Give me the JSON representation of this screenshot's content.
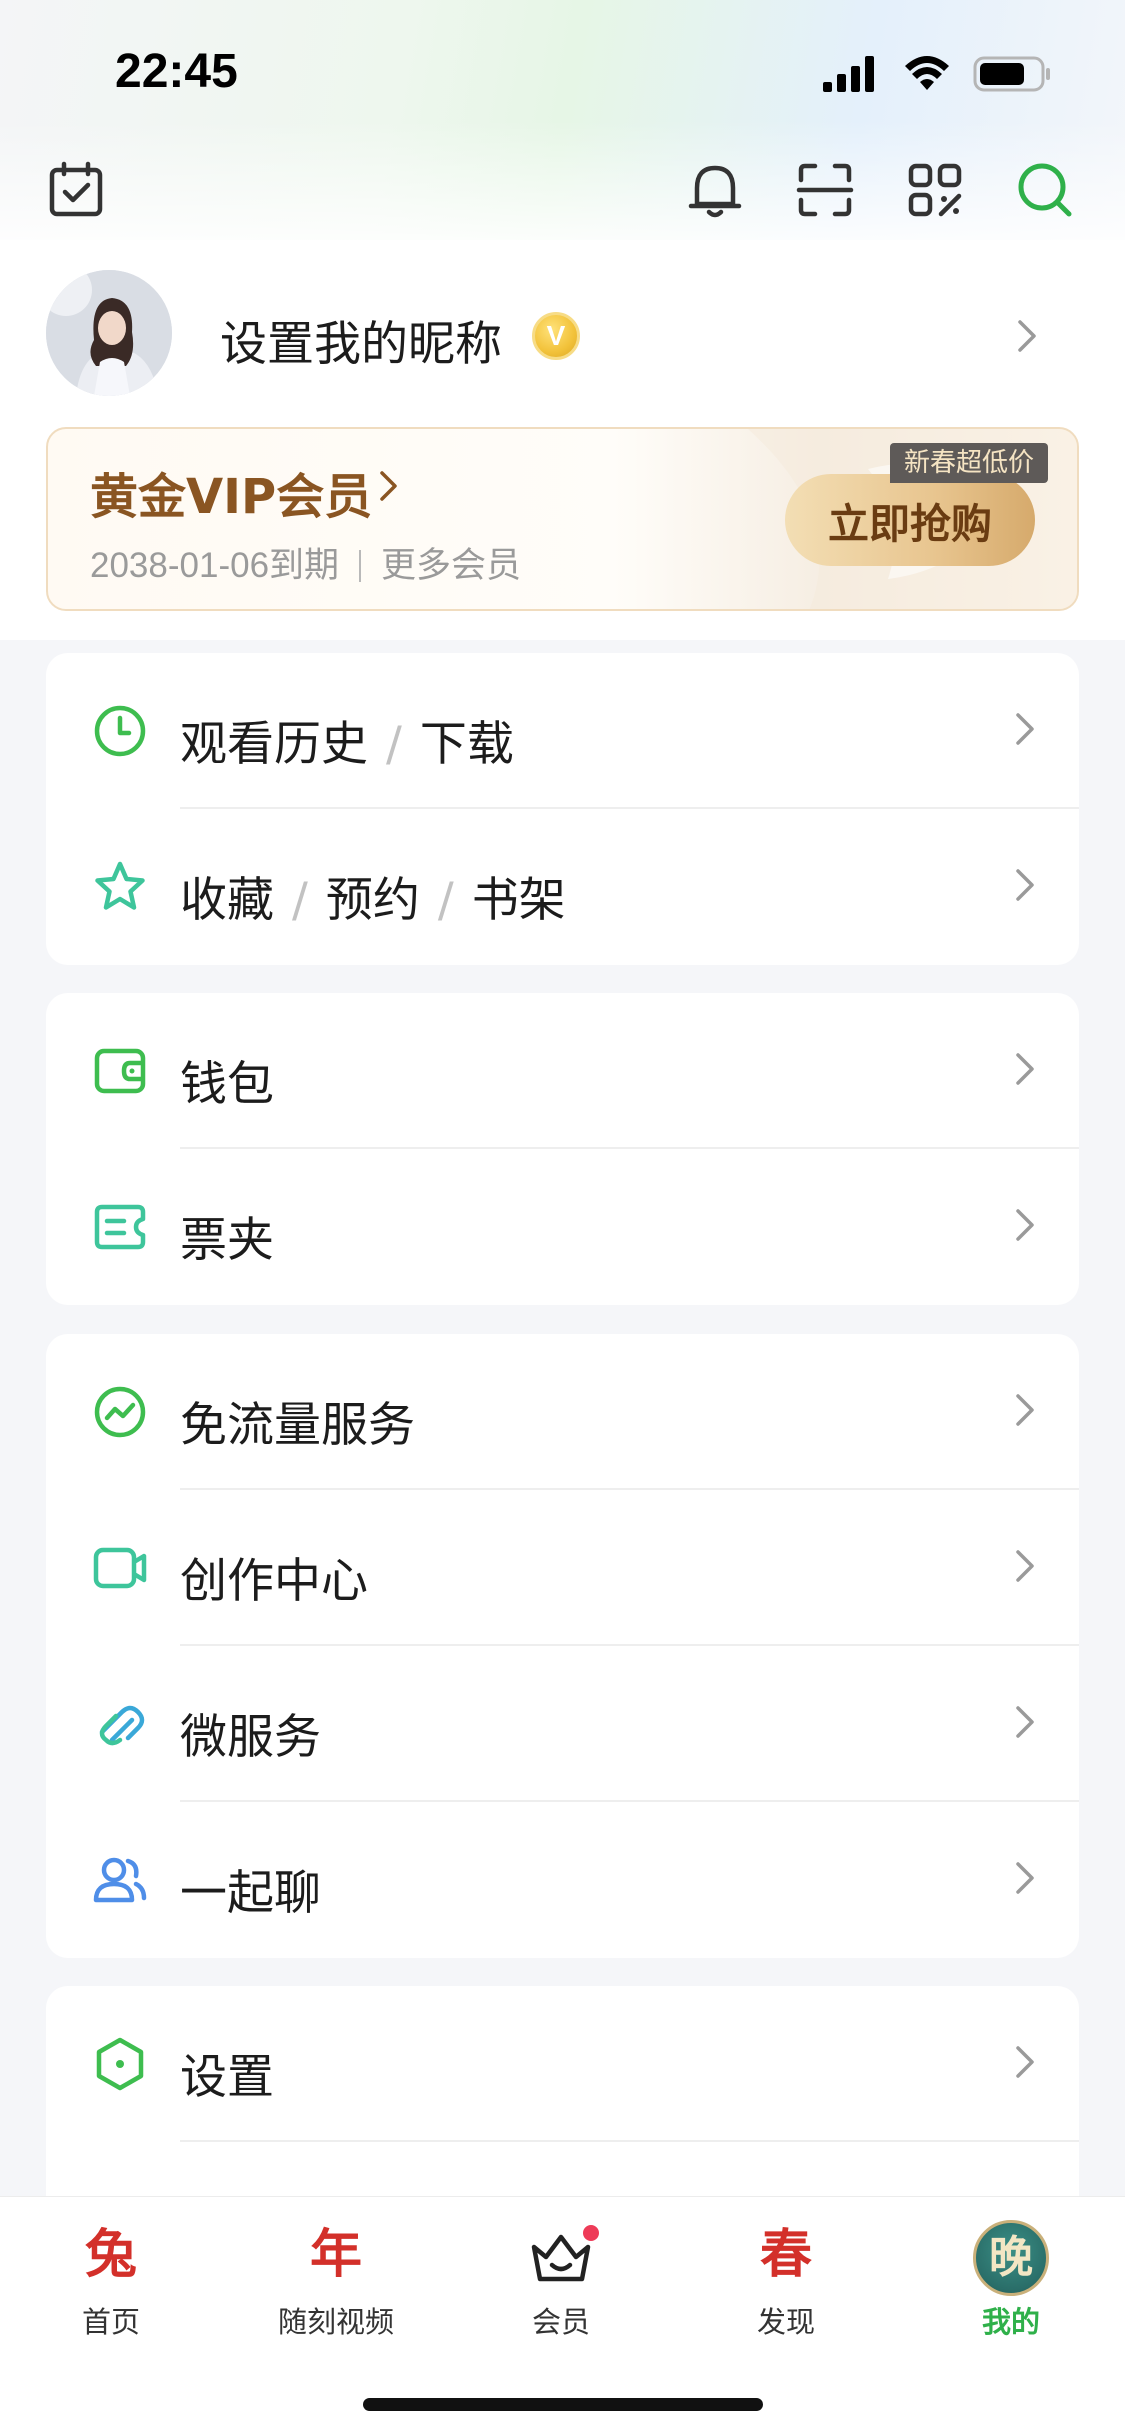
{
  "status_bar": {
    "time": "22:45"
  },
  "header": {
    "icons": [
      "calendar-check-icon",
      "bell-icon",
      "scan-icon",
      "qr-code-icon",
      "search-icon"
    ]
  },
  "profile": {
    "nickname": "设置我的昵称",
    "badge": "V"
  },
  "vip": {
    "title": "黄金VIP会员",
    "expire": "2038-01-06到期",
    "more": "更多会员",
    "buy_label": "立即抢购",
    "tag": "新春超低价"
  },
  "menu": {
    "history": {
      "a": "观看历史",
      "sep": "/",
      "b": "下载"
    },
    "favorites": {
      "a": "收藏",
      "sep1": "/",
      "b": "预约",
      "sep2": "/",
      "c": "书架"
    },
    "wallet": "钱包",
    "tickets": "票夹",
    "free_data": "免流量服务",
    "creator": "创作中心",
    "micro_service": "微服务",
    "chat": "一起聊",
    "settings": "设置"
  },
  "tabbar": {
    "items": [
      {
        "glyph": "兔",
        "label": "首页"
      },
      {
        "glyph": "年",
        "label": "随刻视频"
      },
      {
        "glyph": "",
        "label": "会员"
      },
      {
        "glyph": "春",
        "label": "发现"
      },
      {
        "glyph": "晚",
        "label": "我的"
      }
    ],
    "active": "我的"
  },
  "colors": {
    "accent_green": "#2fb04a",
    "vip_brown": "#8a5522",
    "festival_red": "#d3302a"
  }
}
